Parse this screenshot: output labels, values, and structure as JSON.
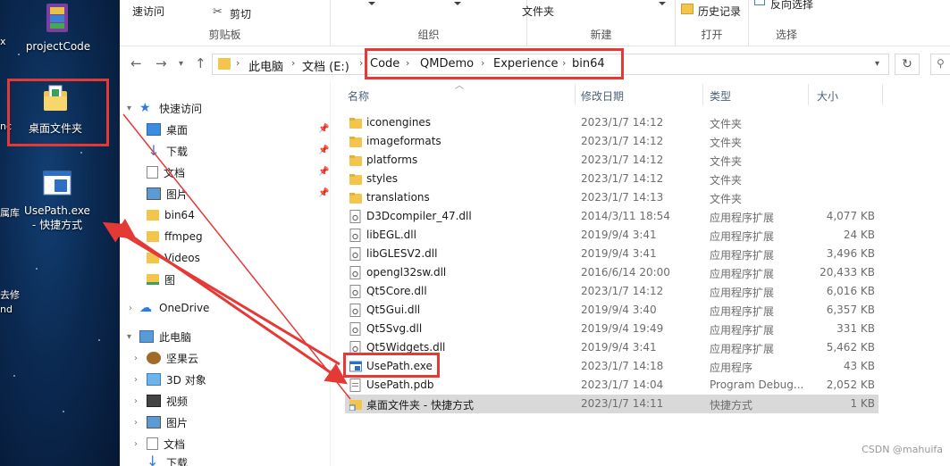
{
  "desktop": {
    "items": [
      {
        "label": "projectCode"
      },
      {
        "label": "桌面文件夹"
      },
      {
        "label": "UsePath.exe",
        "label2": "- 快捷方式"
      }
    ],
    "edge_texts": [
      "x",
      "nc",
      "属库",
      "去修",
      "nd"
    ]
  },
  "ribbon": {
    "groups": [
      {
        "caption": "剪贴板",
        "items": [
          "速访问",
          "剪切"
        ]
      },
      {
        "caption": "组织",
        "items": []
      },
      {
        "caption": "新建",
        "items": [
          "文件夹"
        ]
      },
      {
        "caption": "打开",
        "items": [
          "历史记录"
        ]
      },
      {
        "caption": "选择",
        "items": [
          "反向选择"
        ]
      }
    ]
  },
  "address": {
    "crumbs": [
      "此电脑",
      "文档 (E:)",
      "Code",
      "QMDemo",
      "Experience",
      "bin64"
    ]
  },
  "nav": {
    "quick_access": "快速访问",
    "items": [
      {
        "label": "桌面",
        "pinned": true
      },
      {
        "label": "下载",
        "pinned": true
      },
      {
        "label": "文档",
        "pinned": true
      },
      {
        "label": "图片",
        "pinned": true
      },
      {
        "label": "bin64",
        "pinned": false
      },
      {
        "label": "ffmpeg",
        "pinned": false
      },
      {
        "label": "Videos",
        "pinned": false
      },
      {
        "label": "图",
        "pinned": false
      }
    ],
    "onedrive": "OneDrive",
    "this_pc": "此电脑",
    "pc_items": [
      "坚果云",
      "3D 对象",
      "视频",
      "图片",
      "文档",
      "下载"
    ]
  },
  "columns": {
    "name": "名称",
    "date": "修改日期",
    "type": "类型",
    "size": "大小"
  },
  "files": [
    {
      "name": "iconengines",
      "date": "2023/1/7 14:12",
      "type": "文件夹",
      "size": "",
      "icon": "folder-icon"
    },
    {
      "name": "imageformats",
      "date": "2023/1/7 14:12",
      "type": "文件夹",
      "size": "",
      "icon": "folder-icon"
    },
    {
      "name": "platforms",
      "date": "2023/1/7 14:12",
      "type": "文件夹",
      "size": "",
      "icon": "folder-icon"
    },
    {
      "name": "styles",
      "date": "2023/1/7 14:12",
      "type": "文件夹",
      "size": "",
      "icon": "folder-icon"
    },
    {
      "name": "translations",
      "date": "2023/1/7 14:13",
      "type": "文件夹",
      "size": "",
      "icon": "folder-icon"
    },
    {
      "name": "D3Dcompiler_47.dll",
      "date": "2014/3/11 18:54",
      "type": "应用程序扩展",
      "size": "4,077 KB",
      "icon": "dll-icon"
    },
    {
      "name": "libEGL.dll",
      "date": "2019/9/4 3:41",
      "type": "应用程序扩展",
      "size": "24 KB",
      "icon": "dll-icon"
    },
    {
      "name": "libGLESV2.dll",
      "date": "2019/9/4 3:41",
      "type": "应用程序扩展",
      "size": "3,496 KB",
      "icon": "dll-icon"
    },
    {
      "name": "opengl32sw.dll",
      "date": "2016/6/14 20:00",
      "type": "应用程序扩展",
      "size": "20,433 KB",
      "icon": "dll-icon"
    },
    {
      "name": "Qt5Core.dll",
      "date": "2023/1/7 14:12",
      "type": "应用程序扩展",
      "size": "6,016 KB",
      "icon": "dll-icon"
    },
    {
      "name": "Qt5Gui.dll",
      "date": "2019/9/4 3:40",
      "type": "应用程序扩展",
      "size": "6,357 KB",
      "icon": "dll-icon"
    },
    {
      "name": "Qt5Svg.dll",
      "date": "2019/9/4 19:49",
      "type": "应用程序扩展",
      "size": "331 KB",
      "icon": "dll-icon"
    },
    {
      "name": "Qt5Widgets.dll",
      "date": "2019/9/4 3:41",
      "type": "应用程序扩展",
      "size": "5,462 KB",
      "icon": "dll-icon"
    },
    {
      "name": "UsePath.exe",
      "date": "2023/1/7 14:18",
      "type": "应用程序",
      "size": "43 KB",
      "icon": "exe-icon"
    },
    {
      "name": "UsePath.pdb",
      "date": "2023/1/7 14:04",
      "type": "Program Debug...",
      "size": "2,052 KB",
      "icon": "pdb-icon"
    },
    {
      "name": "桌面文件夹 - 快捷方式",
      "date": "2023/1/7 14:11",
      "type": "快捷方式",
      "size": "1 KB",
      "icon": "shortcut-icon",
      "selected": true
    }
  ],
  "watermark": "CSDN @mahuifa",
  "colors": {
    "annotation_red": "#e53935",
    "folder_yellow": "#f4c54d",
    "selection_gray": "#d9d9d9"
  }
}
